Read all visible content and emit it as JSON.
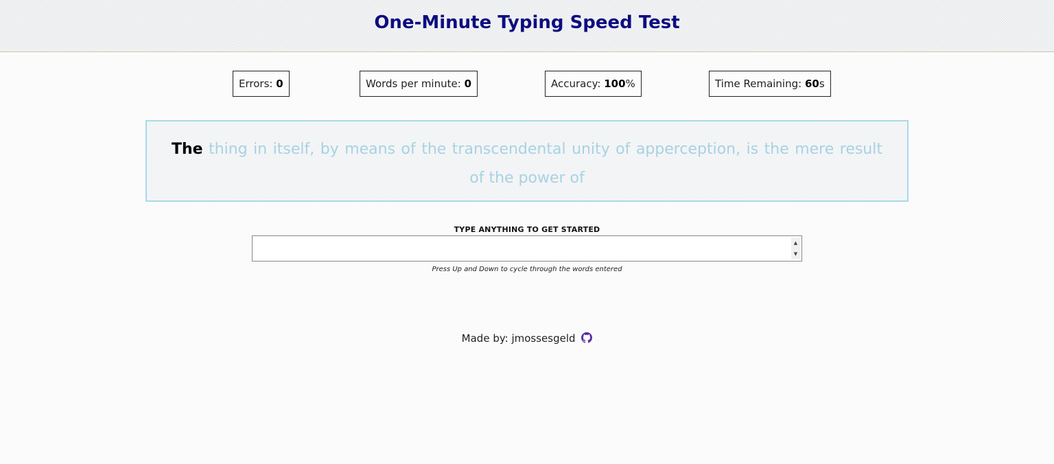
{
  "header": {
    "title": "One-Minute Typing Speed Test"
  },
  "stats": {
    "errors": {
      "label": "Errors: ",
      "value": "0",
      "suffix": ""
    },
    "wpm": {
      "label": "Words per minute: ",
      "value": "0",
      "suffix": ""
    },
    "accuracy": {
      "label": "Accuracy: ",
      "value": "100",
      "suffix": "%"
    },
    "time": {
      "label": "Time Remaining: ",
      "value": "60",
      "suffix": "s"
    }
  },
  "passage": {
    "current_word": "The",
    "remaining_text": "thing in itself, by means of the transcendental unity of apperception, is the mere result of the power of"
  },
  "input": {
    "label": "TYPE ANYTHING TO GET STARTED",
    "value": "",
    "hint": "Press Up and Down to cycle through the words entered",
    "spinner_up": "▲",
    "spinner_down": "▼"
  },
  "footer": {
    "text": "Made by: jmossesgeld",
    "icon": "github-icon"
  },
  "colors": {
    "title": "#0d0d80",
    "passage_border": "#a9d9e9",
    "remaining_text": "#a7d2e4",
    "github_icon": "#5a2ea6"
  }
}
